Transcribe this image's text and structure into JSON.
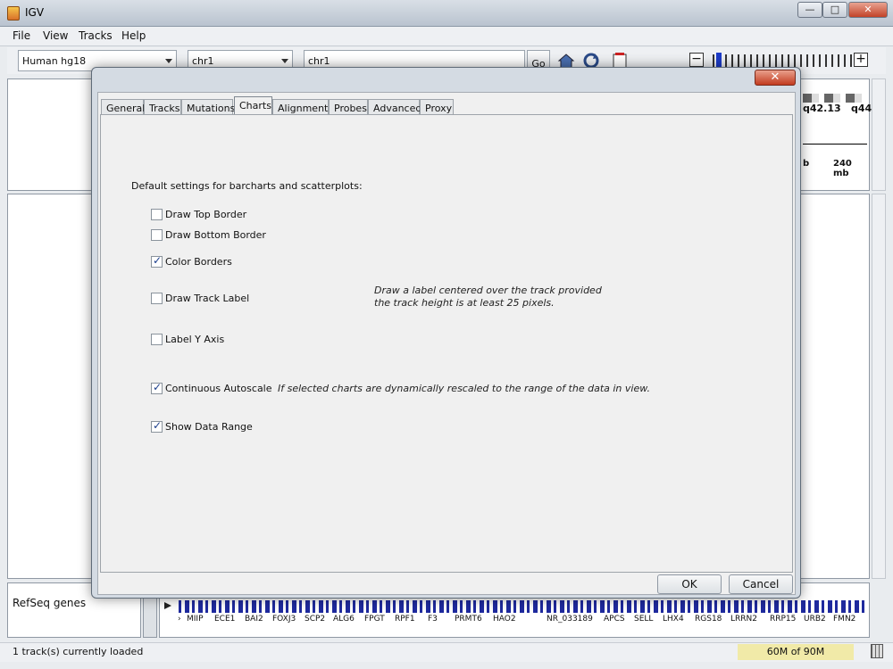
{
  "window": {
    "title": "IGV",
    "controls": [
      "—",
      "□",
      "✕"
    ]
  },
  "menu": [
    "File",
    "View",
    "Tracks",
    "Help"
  ],
  "toolbar": {
    "genome": "Human hg18",
    "chromosome": "chr1",
    "locus": "chr1",
    "go_label": "Go",
    "zoom_minus": "−",
    "zoom_plus": "+"
  },
  "ideogram": {
    "band": "q42.13",
    "band_end": "q44",
    "ruler_left": "b",
    "ruler_right": "240 mb"
  },
  "tracks": {
    "name": "RefSeq genes",
    "genes": [
      "MIIP",
      "ECE1",
      "BAI2",
      "FOXJ3",
      "SCP2",
      "ALG6",
      "FPGT",
      "RPF1",
      "F3",
      "PRMT6",
      "HAO2",
      "NR_033189",
      "APCS",
      "SELL",
      "LHX4",
      "RGS18",
      "LRRN2",
      "RRP15",
      "URB2",
      "FMN2"
    ]
  },
  "status": {
    "loaded": "1 track(s) currently loaded",
    "memory": "60M of 90M"
  },
  "dialog": {
    "close_label": "✕",
    "tabs": [
      "General",
      "Tracks",
      "Mutations",
      "Charts",
      "Alignments",
      "Probes",
      "Advanced",
      "Proxy"
    ],
    "active_tab": "Charts",
    "heading": "Default settings for barcharts and scatterplots:",
    "options": [
      {
        "label": "Draw Top Border",
        "checked": false
      },
      {
        "label": "Draw Bottom Border",
        "checked": false
      },
      {
        "label": "Color Borders",
        "checked": true
      },
      {
        "label": "Draw Track Label",
        "checked": false
      },
      {
        "label": "Label Y Axis",
        "checked": false
      },
      {
        "label": "Continuous Autoscale",
        "checked": true
      },
      {
        "label": "Show Data Range",
        "checked": true
      }
    ],
    "note_track_label_1": "Draw a label centered over the track provided",
    "note_track_label_2": "the track height is at least 25 pixels.",
    "note_autoscale": "If selected charts are dynamically rescaled to the range of the data in view.",
    "ok_label": "OK",
    "cancel_label": "Cancel"
  }
}
